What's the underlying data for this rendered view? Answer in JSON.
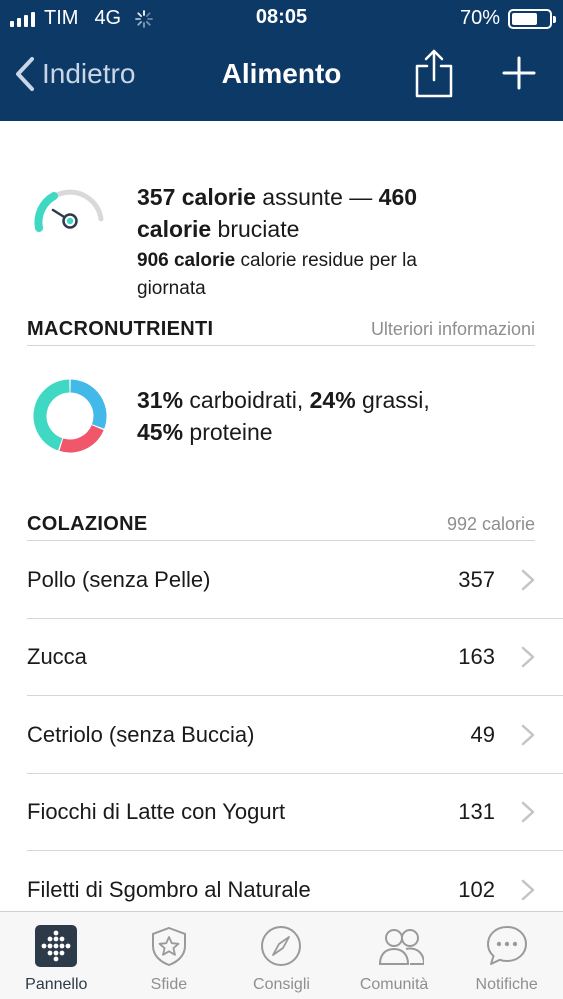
{
  "status_bar": {
    "carrier": "TIM",
    "network": "4G",
    "time": "08:05",
    "battery_percent": "70%",
    "battery_level": 0.7
  },
  "nav": {
    "back_label": "Indietro",
    "title": "Alimento"
  },
  "summary": {
    "consumed_value": "357 calorie",
    "consumed_suffix": " assunte — ",
    "burned_value": "460 calorie",
    "burned_suffix": " bruciate",
    "remaining_value": "906 calorie",
    "remaining_suffix": " calorie residue per la giornata"
  },
  "macros": {
    "title": "MACRONUTRIENTI",
    "link": "Ulteriori informazioni",
    "carbs_pct": "31%",
    "carbs_label": " carboidrati, ",
    "fat_pct": "24%",
    "fat_label": " grassi, ",
    "protein_pct": "45%",
    "protein_label": " proteine",
    "chart_values": {
      "carboidrati": 31,
      "grassi": 24,
      "proteine": 45
    },
    "colors": {
      "carboidrati": "#43b9e9",
      "grassi": "#f0576a",
      "proteine": "#3ed8c3"
    }
  },
  "breakfast": {
    "title": "COLAZIONE",
    "total": "992 calorie",
    "items": [
      {
        "name": "Pollo (senza Pelle)",
        "calories": "357"
      },
      {
        "name": "Zucca",
        "calories": "163"
      },
      {
        "name": "Cetriolo (senza Buccia)",
        "calories": "49"
      },
      {
        "name": "Fiocchi di Latte con Yogurt",
        "calories": "131"
      },
      {
        "name": "Filetti di Sgombro al Naturale",
        "calories": "102"
      }
    ]
  },
  "tabs": [
    {
      "label": "Pannello",
      "icon": "dashboard-icon"
    },
    {
      "label": "Sfide",
      "icon": "challenge-star-icon"
    },
    {
      "label": "Consigli",
      "icon": "compass-icon"
    },
    {
      "label": "Comunità",
      "icon": "community-icon"
    },
    {
      "label": "Notifiche",
      "icon": "chat-bubble-icon"
    }
  ],
  "theme": {
    "header_bg": "#0d3966",
    "accent_teal": "#3ed8c3",
    "gauge_track": "#d9d9d9"
  }
}
